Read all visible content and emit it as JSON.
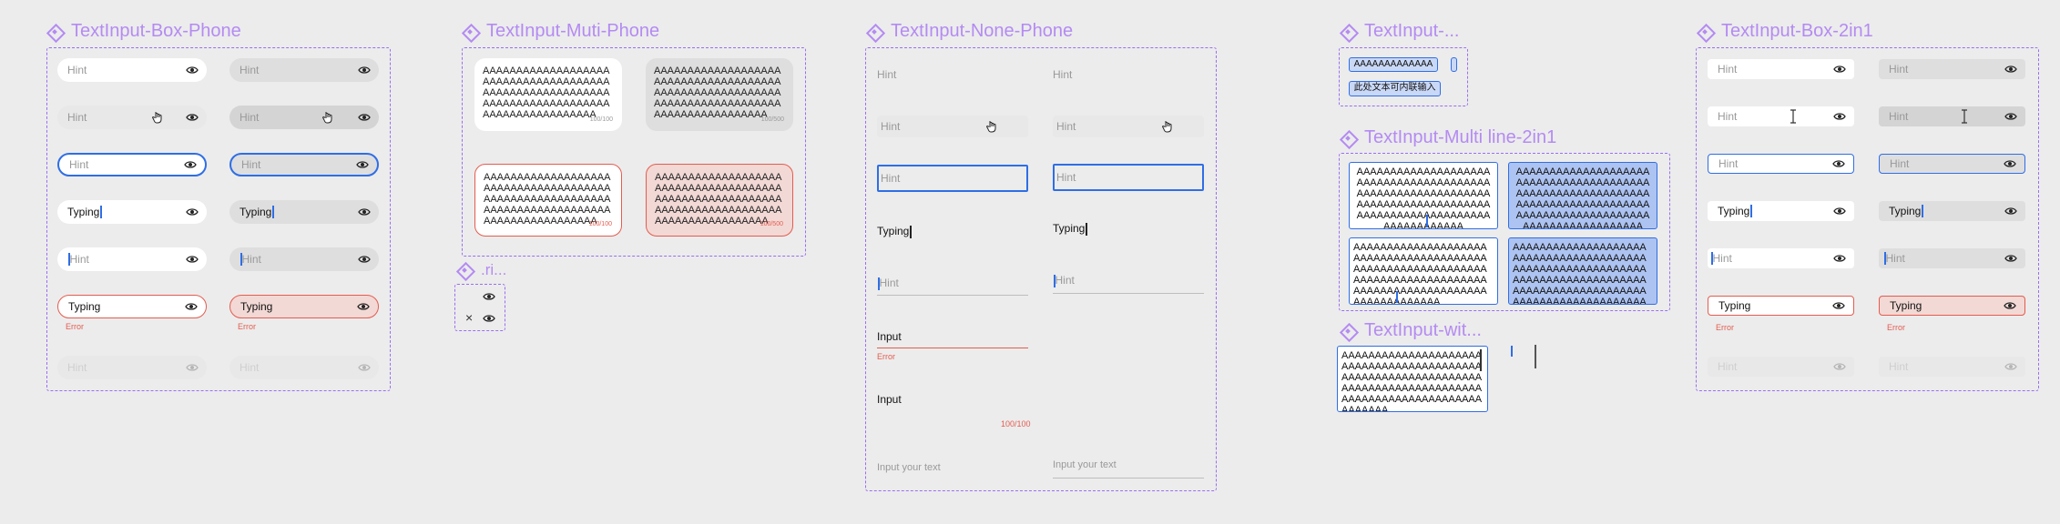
{
  "frames": {
    "box_phone": "TextInput-Box-Phone",
    "muti_phone": "TextInput-Muti-Phone",
    "none_phone": "TextInput-None-Phone",
    "small_title": "TextInput-...",
    "multi_2in1": "TextInput-Multi line-2in1",
    "wit": "TextInput-wit...",
    "box_2in1": "TextInput-Box-2in1",
    "ri": ".ri..."
  },
  "field": {
    "hint": "Hint",
    "typing": "Typing",
    "error": "Error",
    "input": "Input",
    "input_your_text": "Input your text",
    "counter_100": "100/100"
  },
  "multi": {
    "long_text": "AAAAAAAAAAAAAAAAAAAAAAAAAAAAAAAAAAAAAAAAAAAAAAAAAAAAAAAAAAAAAAAAAAAAAAAAAAAAAAAAAAAAAAAAAAAAA",
    "count_normal": "100/100",
    "count_grey": "100/500",
    "count_error1": "100/100",
    "count_error2": "100/500"
  },
  "small": {
    "field1": "AAAAAAAAAAAAAA",
    "field2": "此处文本可内联输入"
  },
  "twoin1": {
    "text_a": "AAAAAAAAAAAAAAAAAAAAAAAAAAAAAAAAAAAAAAAAAAAAAAAAAAAAAAAAAAAAAAAAAAAAAAAAAAAAAAAAAAAAAAAAAAAAAAAAAAAAAAAAAAAAAAAA",
    "text_b": "AAAAAAAAAAAAAAAAAAAAAAAAAAAAAAAAAAAAAAAAAAAAAAAAAAAAAAAAAAAAAAAAAAAAAAAAAAAAAAAAAAAAAAAAAAAAAAAAAAAAAAAAAAAAAAAAAAAAAA",
    "text_c": "AAAAAAAAAAAAAAAAAAAAAAAAAAAAAAAAAAAAAAAAAAAAAAAAAAAAAAAAAAAAAAAAAAAAAAAAAAAAAAAAAAAAAAAAAAAAAAAAAAAAAAAAAAAAAAAAA",
    "text_d": "AAAAAAAAAAAAAAAAAAAAAAAAAAAAAAAAAAAAAAAAAAAAAAAAAAAAAAAAAAAAAAAAAAAAAAAAAAAAAAAAAAAAAAAAAAAAAAAAAAAAAAAAAAAAAAAAAAAAAAAAAA"
  },
  "wit": {
    "text": "AAAAAAAAAAAAAAAAAAAAAAAAAAAAAAAAAAAAAAAAAAAAAAAAAAAAAAAAAAAAAAAAAAAAAAAAAAAAAAAAAAAAAAAAAAAAAAAAAAAAAAAAAAAAAAAA"
  },
  "colors": {
    "frame_purple": "#9a6ef0",
    "title_purple": "#b48bf2",
    "focus_blue": "#2f6ee5",
    "error_red": "#e45c4f",
    "selected_fill": "#adc3f1"
  },
  "icons": [
    "eye-icon",
    "close-icon",
    "hand-cursor-icon",
    "text-cursor-icon"
  ]
}
